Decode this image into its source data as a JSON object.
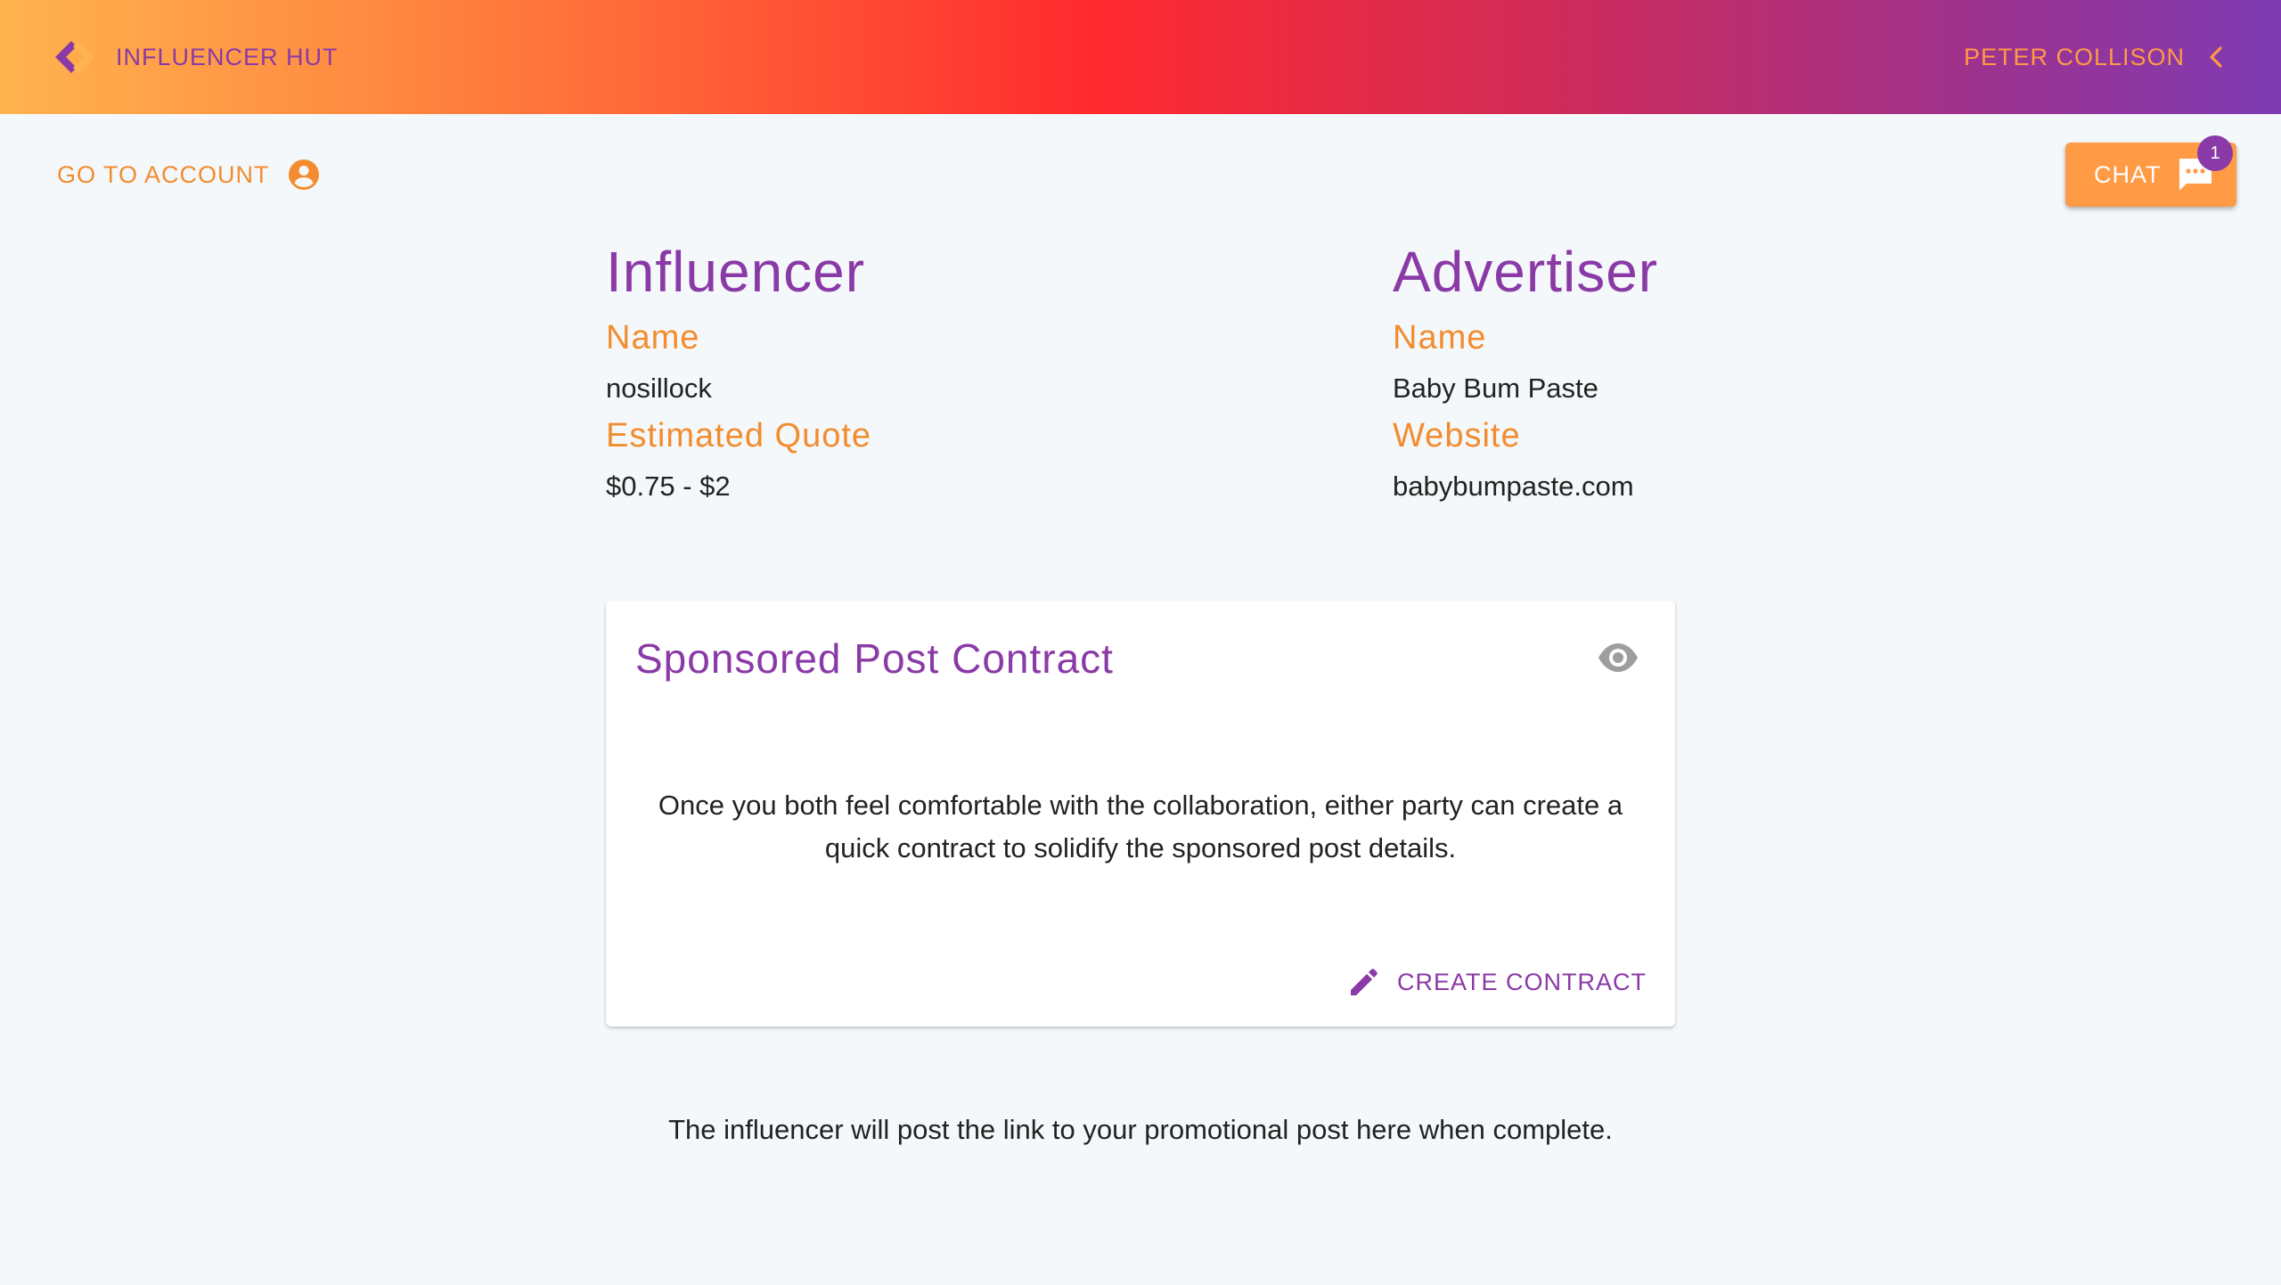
{
  "header": {
    "brand_name": "INFLUENCER HUT",
    "user_name": "PETER COLLISON",
    "logo_icon": "link-logo-icon",
    "menu_icon": "chevron-left-icon"
  },
  "toolbar": {
    "account_label": "GO TO ACCOUNT",
    "account_icon": "account-circle-icon",
    "chat_label": "CHAT",
    "chat_icon": "chat-bubble-icon",
    "chat_badge": "1"
  },
  "influencer": {
    "heading": "Influencer",
    "name_label": "Name",
    "name_value": "nosillock",
    "quote_label": "Estimated Quote",
    "quote_value": "$0.75 - $2"
  },
  "advertiser": {
    "heading": "Advertiser",
    "name_label": "Name",
    "name_value": "Baby Bum Paste",
    "website_label": "Website",
    "website_value": "babybumpaste.com"
  },
  "contract_card": {
    "title": "Sponsored Post Contract",
    "view_icon": "eye-icon",
    "body": "Once you both feel comfortable with the collaboration, either party can create a quick contract to solidify the sponsored post details.",
    "action_label": "CREATE CONTRACT",
    "action_icon": "pencil-icon"
  },
  "footer_note": "The influencer will post the link to your promotional post here when complete.",
  "colors": {
    "purple": "#8a3aa6",
    "orange": "#f28c2f",
    "chat_orange": "#ff9a45",
    "background": "#f5f8fa"
  }
}
